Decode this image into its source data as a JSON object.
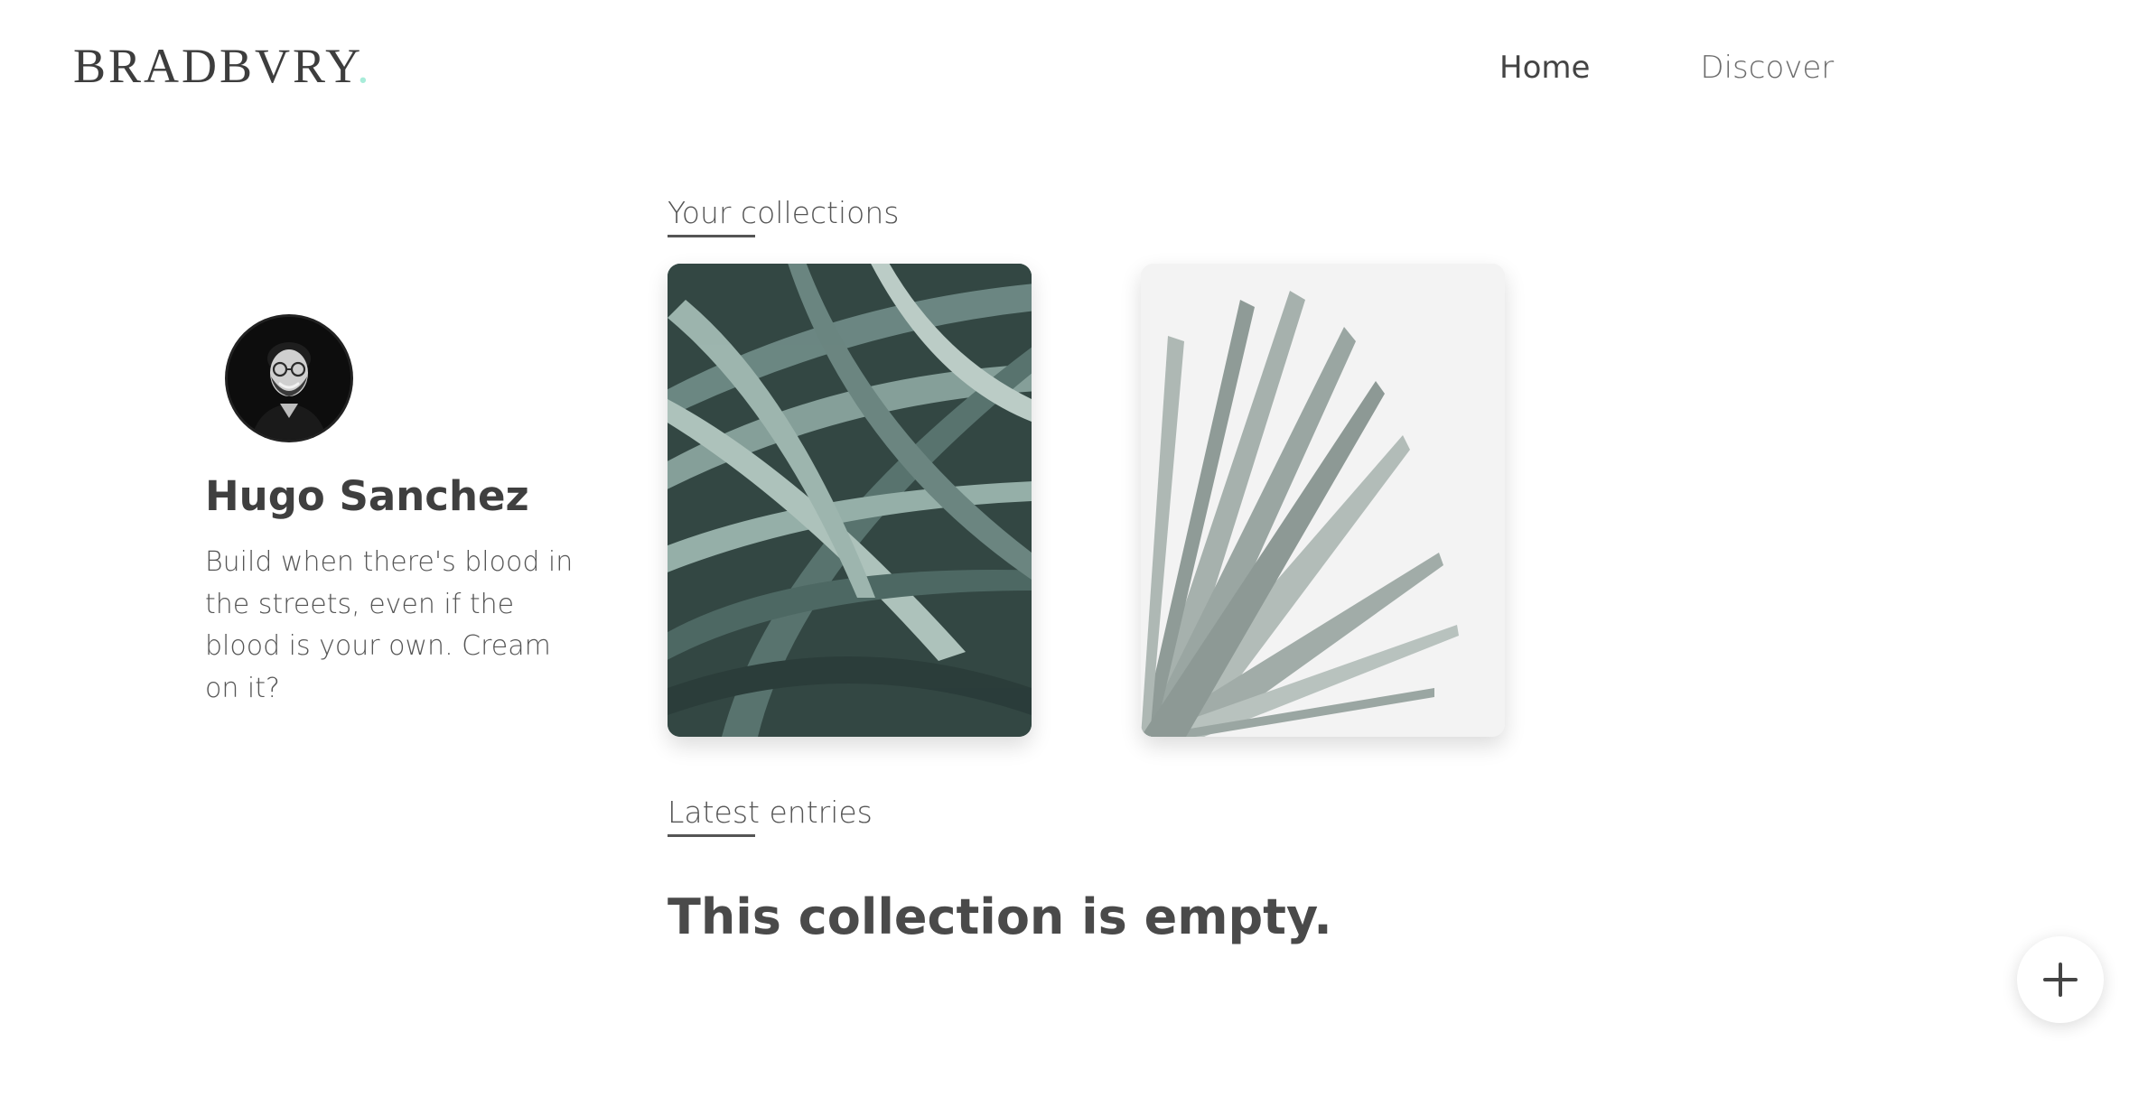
{
  "header": {
    "logo": "BRADBVRY",
    "logo_dot": ".",
    "nav": {
      "home": "Home",
      "discover": "Discover"
    }
  },
  "profile": {
    "name": "Hugo Sanchez",
    "bio": "Build when there's blood in the streets, even if the blood is your own. Cream on it?"
  },
  "collections": {
    "heading": "Your collections",
    "cards": [
      {
        "image": "dark green palm leaves photo"
      },
      {
        "image": "pale silver palm frond photo"
      }
    ]
  },
  "latest": {
    "heading": "Latest entries",
    "empty_message": "This collection is empty."
  },
  "icons": {
    "fab": "plus-icon"
  },
  "colors": {
    "accent_dot": "#a8ecd9",
    "text": "#444444"
  }
}
